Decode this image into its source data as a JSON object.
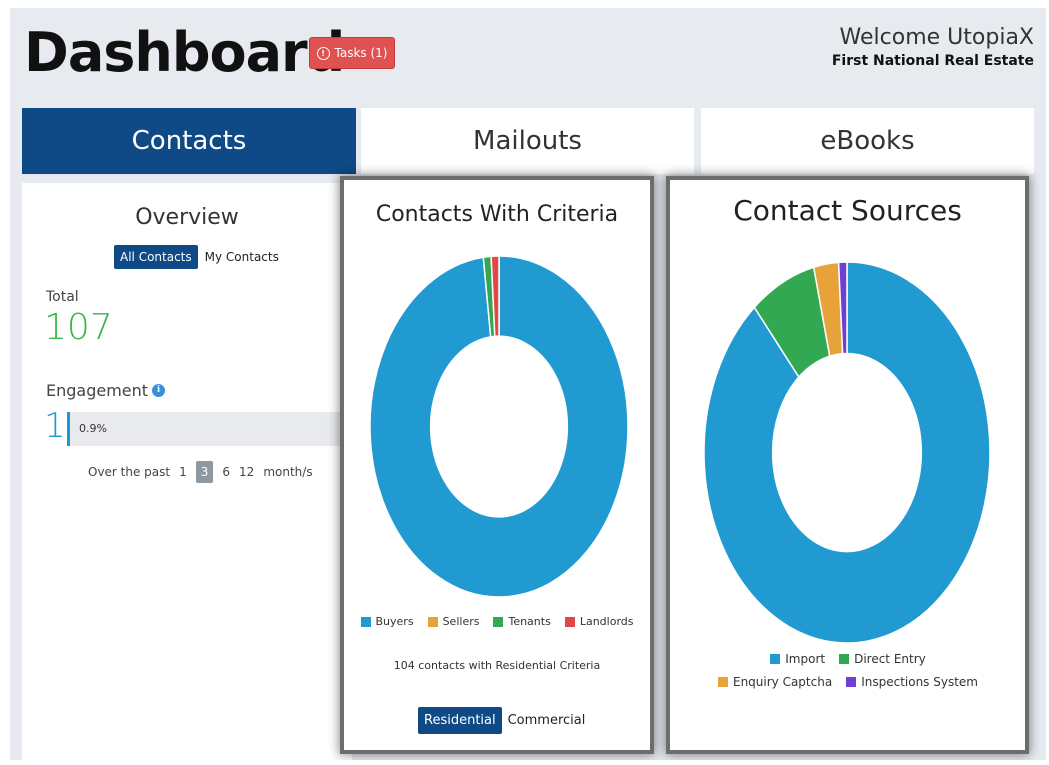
{
  "header": {
    "title": "Dashboard",
    "tasks_label": "Tasks (1)",
    "welcome": "Welcome UtopiaX",
    "company": "First National Real Estate"
  },
  "tabs": [
    {
      "label": "Contacts",
      "active": true
    },
    {
      "label": "Mailouts",
      "active": false
    },
    {
      "label": "eBooks",
      "active": false
    }
  ],
  "overview": {
    "title": "Overview",
    "toggle": [
      "All Contacts",
      "My Contacts"
    ],
    "total_label": "Total",
    "total_value": "107",
    "engagement_label": "Engagement",
    "engagement_value": "1",
    "engagement_percent": "0.9%",
    "engagement_fraction": 0.009,
    "period_label": "Over the past",
    "period_options": [
      "1",
      "3",
      "6",
      "12"
    ],
    "period_selected": "3",
    "period_unit": "month/s"
  },
  "criteria_card": {
    "title": "Contacts With Criteria",
    "count_text": "104 contacts with Residential Criteria",
    "toggle": [
      "Residential",
      "Commercial"
    ]
  },
  "sources_card": {
    "title": "Contact Sources"
  },
  "colors": {
    "accent": "#0f4a86",
    "blue": "#2199d1",
    "orange": "#e8a23a",
    "green": "#33a852",
    "red": "#e04848",
    "purple": "#6f3fd3",
    "total_green": "#38b54a"
  },
  "chart_data": [
    {
      "type": "pie",
      "title": "Contacts With Criteria",
      "categories": [
        "Buyers",
        "Sellers",
        "Tenants",
        "Landlords"
      ],
      "values": [
        101,
        0,
        1,
        1
      ],
      "colors": [
        "#2199d1",
        "#e8a23a",
        "#33a852",
        "#e04848"
      ],
      "legend": "bottom"
    },
    {
      "type": "pie",
      "title": "Contact Sources",
      "categories": [
        "Import",
        "Direct Entry",
        "Enquiry Captcha",
        "Inspections System"
      ],
      "values": [
        95,
        8,
        3,
        1
      ],
      "colors": [
        "#2199d1",
        "#33a852",
        "#e8a23a",
        "#6f3fd3"
      ],
      "legend": "bottom"
    }
  ]
}
